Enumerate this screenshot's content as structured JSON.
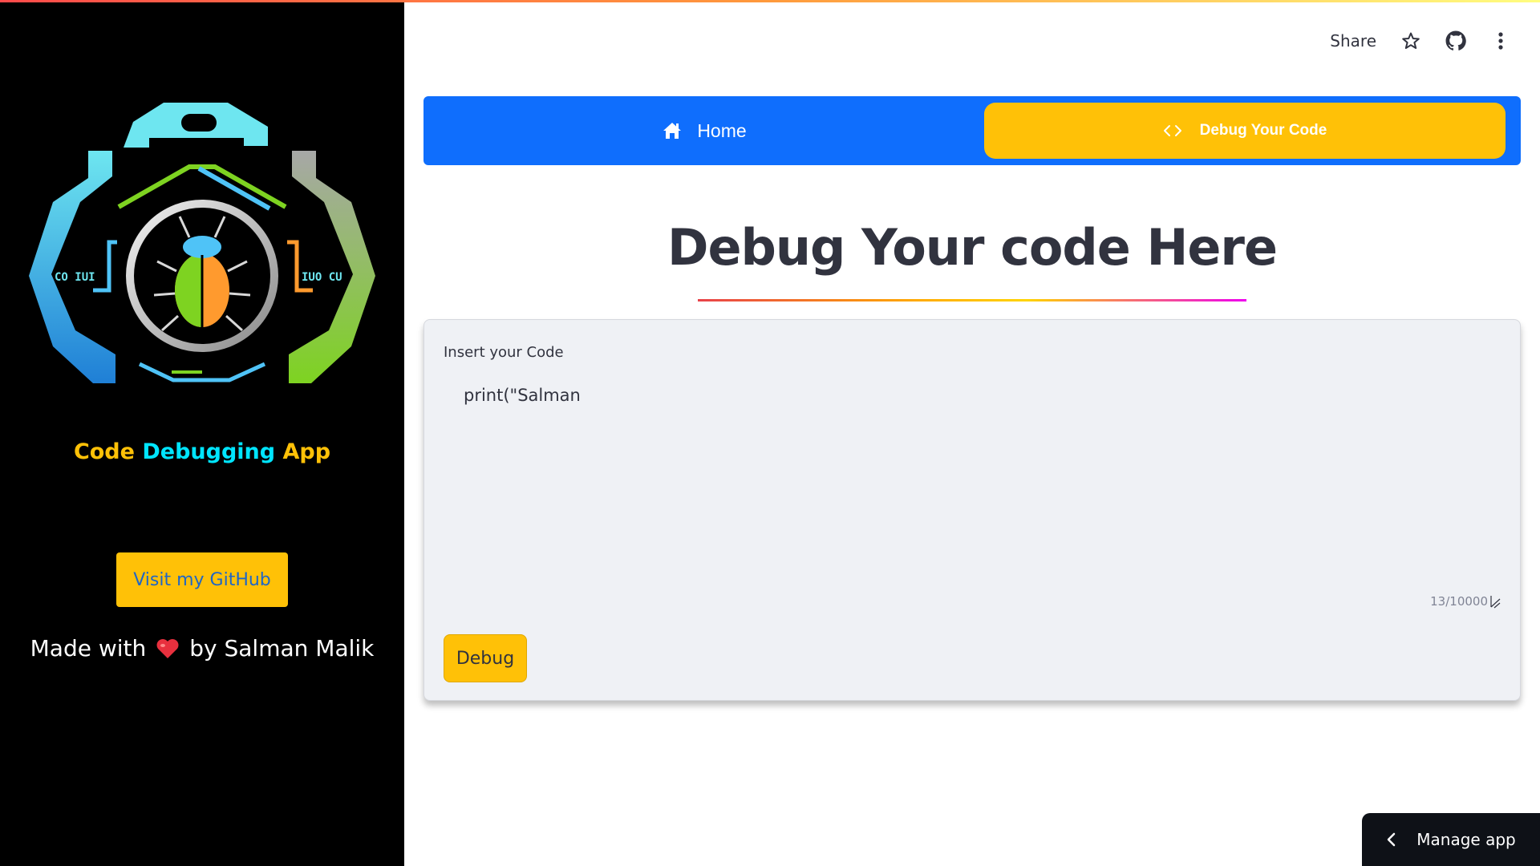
{
  "sidebar": {
    "app_title": {
      "part1": "Code",
      "part2": "Debugging",
      "part3": "App"
    },
    "github_button": "Visit my GitHub",
    "made_with_prefix": "Made with",
    "made_with_suffix": "by Salman Malik",
    "logo_text_left": "CO IUI",
    "logo_text_right": "IUO CU"
  },
  "toolbar": {
    "share_label": "Share",
    "icons": [
      "star-icon",
      "github-icon",
      "more-vertical-icon"
    ]
  },
  "nav": {
    "home_label": "Home",
    "debug_label": "Debug Your Code",
    "active": "Debug Your Code"
  },
  "main": {
    "heading": "Debug Your code Here",
    "input_label": "Insert your Code",
    "code_value": "print(\"Salman",
    "char_count": "13/10000",
    "debug_button": "Debug"
  },
  "footer": {
    "manage_app": "Manage app"
  },
  "colors": {
    "sidebar_bg": "#000000",
    "nav_bg": "#0f6efd",
    "accent_yellow": "#ffc107",
    "cyan": "#00e5ff",
    "card_bg": "#eff1f5"
  }
}
